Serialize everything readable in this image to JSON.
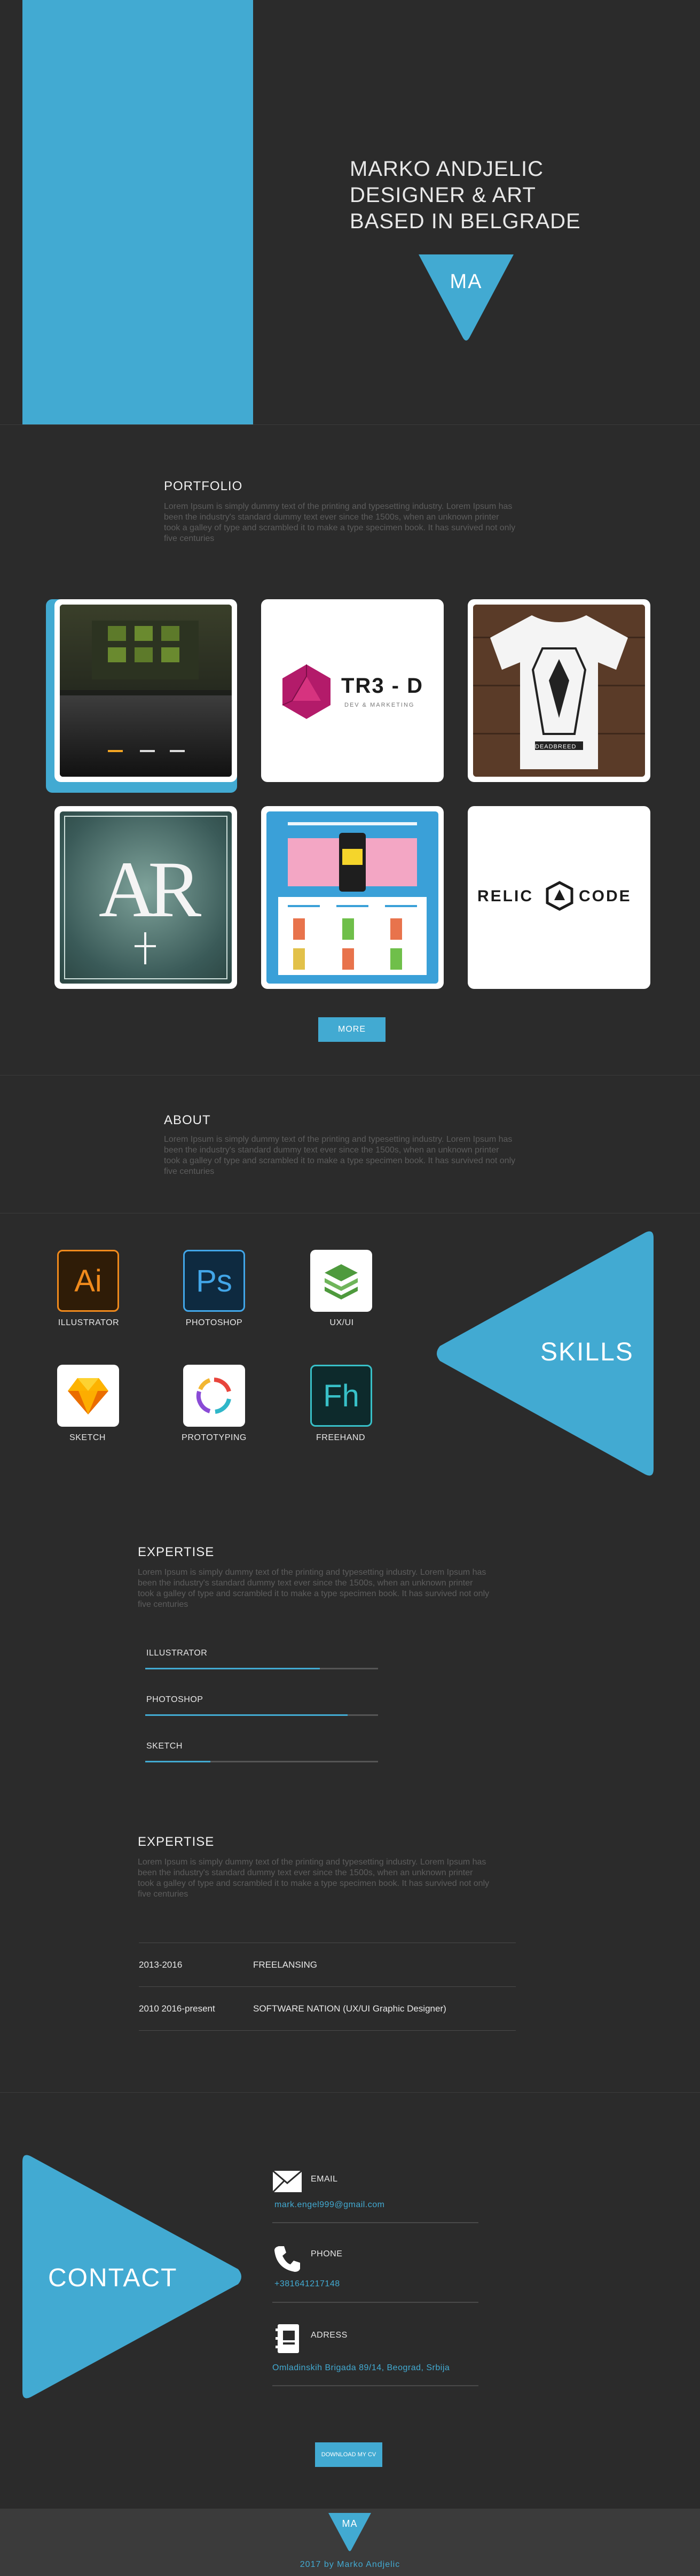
{
  "hero": {
    "title_lines": [
      "MARKO ANDJELIC",
      "DESIGNER & ART",
      "BASED IN BELGRADE"
    ],
    "logo": "MA"
  },
  "portfolio": {
    "heading": "PORTFOLIO",
    "text": "Lorem Ipsum is simply dummy text of the printing and typesetting industry. Lorem Ipsum has been the industry's standard dummy text ever since the 1500s, when an unknown printer took a galley of type and scrambled it to make a type specimen book. It has survived not only five centuries",
    "items": [
      {
        "name": "web-ui-project"
      },
      {
        "name": "tr3d-logo",
        "logo_text": "TR3 - D",
        "sub": "DEV & MARKETING"
      },
      {
        "name": "deadbreed-tshirt",
        "logo_text": "DEADBREED"
      },
      {
        "name": "ar-logo",
        "logo_text": "AR"
      },
      {
        "name": "shop-web-page"
      },
      {
        "name": "relic-code-logo",
        "logo_left": "RELIC",
        "logo_right": "CODE"
      }
    ],
    "more": "MORE"
  },
  "about": {
    "heading": "ABOUT",
    "text": "Lorem Ipsum is simply dummy text of the printing and typesetting industry. Lorem Ipsum has been the industry's standard dummy text ever since the 1500s, when an unknown printer took a galley of type and scrambled it to make a type specimen book. It has survived not only five centuries"
  },
  "skills": {
    "title": "SKILLS",
    "items": [
      {
        "label": "ILLUSTRATOR",
        "icon": "Ai"
      },
      {
        "label": "PHOTOSHOP",
        "icon": "Ps"
      },
      {
        "label": "UX/UI",
        "icon": "layers-icon"
      },
      {
        "label": "SKETCH",
        "icon": "sketch-diamond-icon"
      },
      {
        "label": "PROTOTYPING",
        "icon": "cycle-arrows-icon"
      },
      {
        "label": "FREEHAND",
        "icon": "Fh"
      }
    ]
  },
  "expertise": {
    "heading": "EXPERTISE",
    "text": "Lorem Ipsum is simply dummy text of the printing and typesetting industry. Lorem Ipsum has been the industry's standard dummy text ever since the 1500s, when an unknown printer took a galley of type and scrambled it to make a type specimen book. It has survived not only five centuries",
    "bars": [
      {
        "label": "ILLUSTRATOR",
        "level": 0.75
      },
      {
        "label": "PHOTOSHOP",
        "level": 0.87
      },
      {
        "label": "SKETCH",
        "level": 0.28
      }
    ]
  },
  "experience": {
    "heading": "EXPERTISE",
    "text": "Lorem Ipsum is simply dummy text of the printing and typesetting industry. Lorem Ipsum has been the industry's standard dummy text ever since the 1500s, when an unknown printer took a galley of type and scrambled it to make a type specimen book. It has survived not only five centuries",
    "rows": [
      {
        "date": "2013-2016",
        "role": "FREELANSING"
      },
      {
        "date": "2010 2016-present",
        "role": "SOFTWARE NATION  (UX/UI Graphic Designer)"
      }
    ]
  },
  "contact": {
    "title": "CONTACT",
    "email_label": "EMAIL",
    "email": "mark.engel999@gmail.com",
    "phone_label": "PHONE",
    "phone": "+381641217148",
    "address_label": "ADRESS",
    "address": "Omladinskih Brigada 89/14, Beograd, Srbija",
    "cv_button": "DOWNLOAD MY CV"
  },
  "footer": {
    "logo": "MA",
    "copyright": "2017 by Marko Andjelic"
  },
  "colors": {
    "accent": "#42aad2",
    "background": "#2b2b2b",
    "footer": "#3b3b3b"
  }
}
